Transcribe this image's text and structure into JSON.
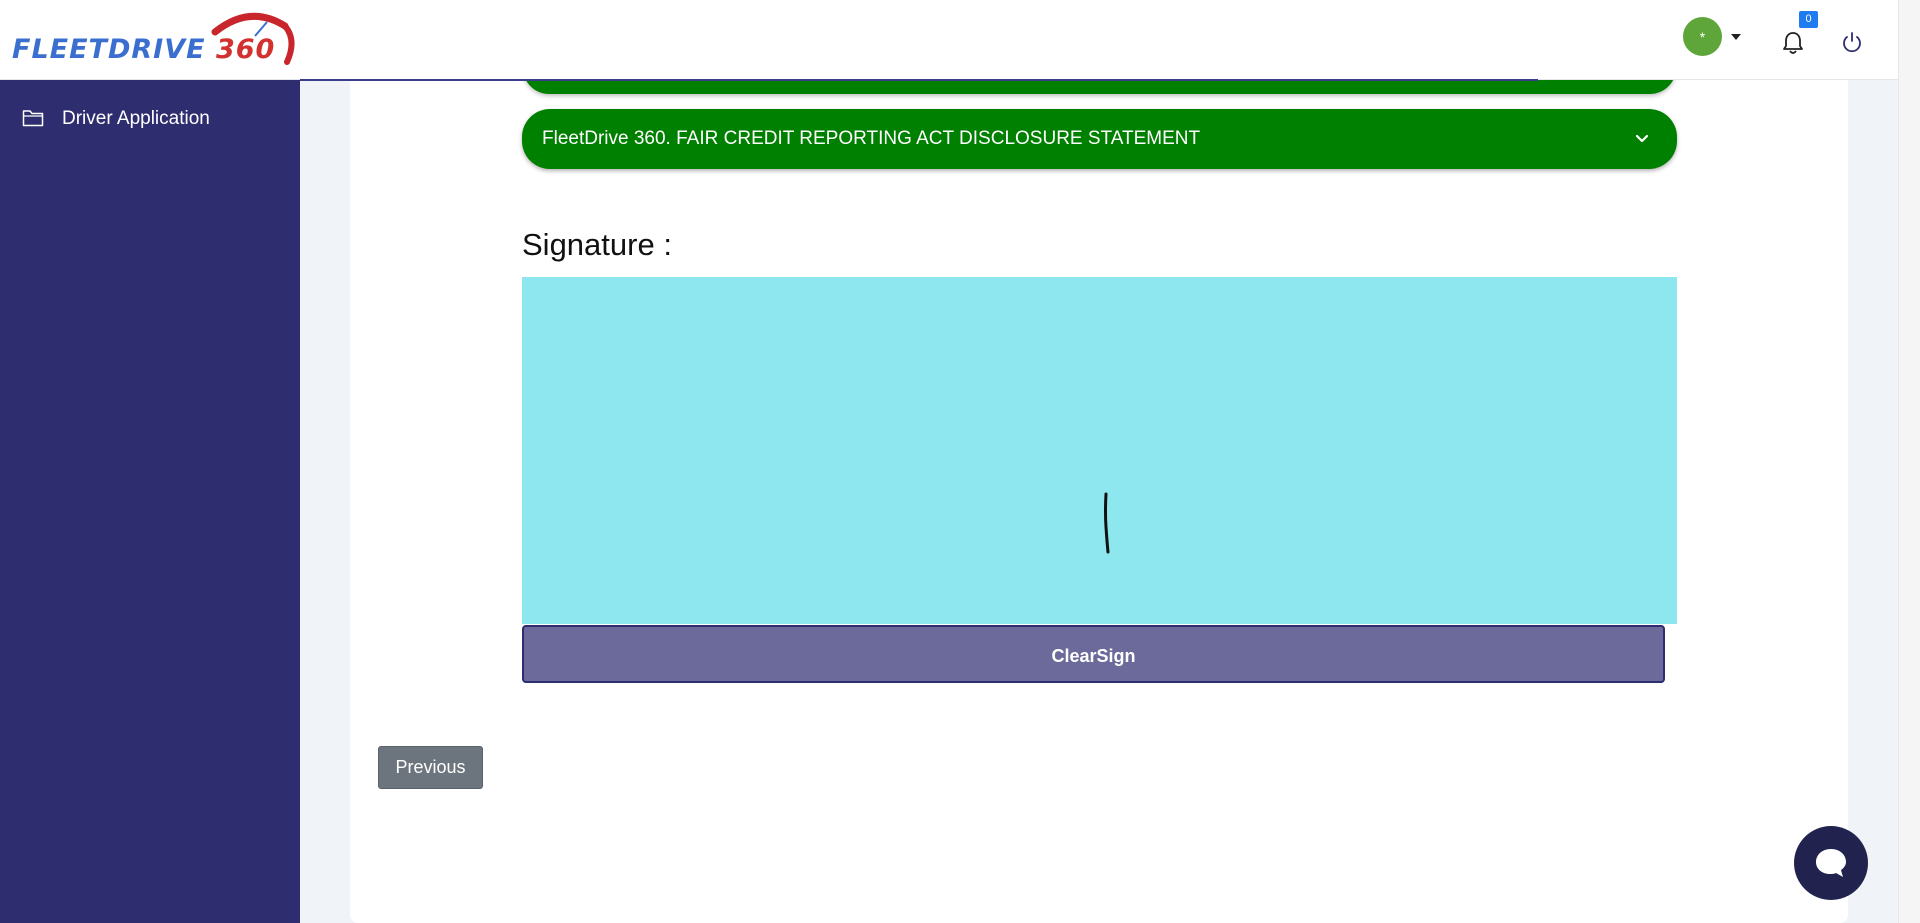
{
  "header": {
    "logo_text": "FLEETDRIVE",
    "logo_number": "360",
    "avatar_glyph": "*",
    "notifications_count": "0",
    "icons": [
      "bell-icon",
      "power-icon",
      "caret-down-icon"
    ]
  },
  "sidebar": {
    "items": [
      {
        "label": "Driver Application",
        "icon": "folder-icon"
      }
    ]
  },
  "main": {
    "accordion_title": "FleetDrive 360. FAIR CREDIT REPORTING ACT DISCLOSURE STATEMENT",
    "signature_label": "Signature :",
    "clear_button": "ClearSign",
    "previous_button": "Previous"
  },
  "colors": {
    "sidebar": "#2e2d6f",
    "accordion": "#008000",
    "signature_pad": "#8ee6ee",
    "clear_button": "#6b6a9b",
    "avatar": "#5ea53a",
    "badge": "#1e7bf0",
    "chat_button": "#22224e"
  }
}
